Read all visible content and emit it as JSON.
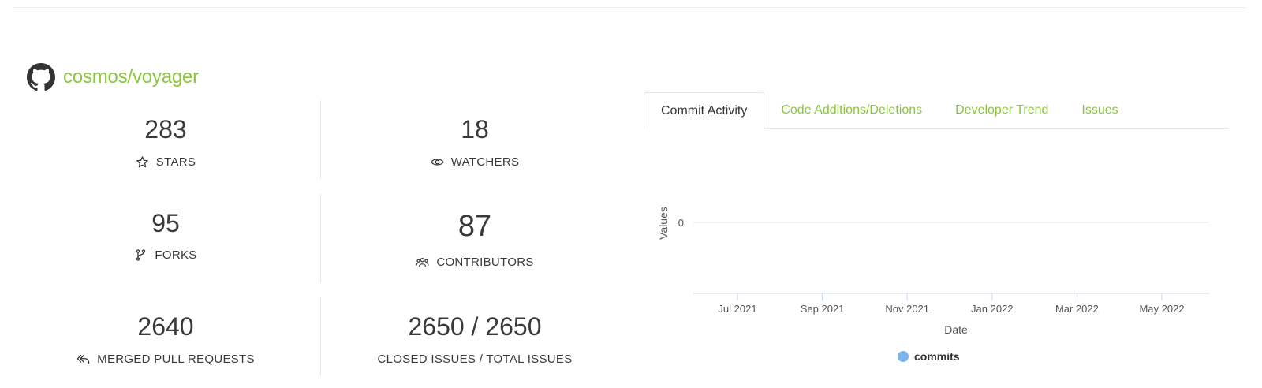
{
  "repo": {
    "name": "cosmos/voyager",
    "icon": "github-icon",
    "accent_color": "#8cc63f"
  },
  "stats": {
    "stars": {
      "value": "283",
      "label": "STARS",
      "icon": "star-icon"
    },
    "watchers": {
      "value": "18",
      "label": "WATCHERS",
      "icon": "eye-icon"
    },
    "forks": {
      "value": "95",
      "label": "FORKS",
      "icon": "fork-icon"
    },
    "contributors": {
      "value": "87",
      "label": "CONTRIBUTORS",
      "icon": "people-icon"
    },
    "merged_prs": {
      "value": "2640",
      "label": "MERGED PULL REQUESTS",
      "icon": "merge-icon"
    },
    "issues": {
      "value": "2650 / 2650",
      "label": "CLOSED ISSUES / TOTAL ISSUES"
    }
  },
  "tabs": [
    {
      "label": "Commit Activity",
      "active": true
    },
    {
      "label": "Code Additions/Deletions",
      "active": false
    },
    {
      "label": "Developer Trend",
      "active": false
    },
    {
      "label": "Issues",
      "active": false
    }
  ],
  "chart_data": {
    "type": "line",
    "xlabel": "Date",
    "ylabel": "Values",
    "x_tick_labels": [
      "Jul 2021",
      "Sep 2021",
      "Nov 2021",
      "Jan 2022",
      "Mar 2022",
      "May 2022"
    ],
    "y_tick_labels": [
      "0"
    ],
    "series": [
      {
        "name": "commits",
        "color": "#7cb5ec",
        "values": []
      }
    ],
    "grid": true,
    "legend_position": "bottom-center"
  }
}
